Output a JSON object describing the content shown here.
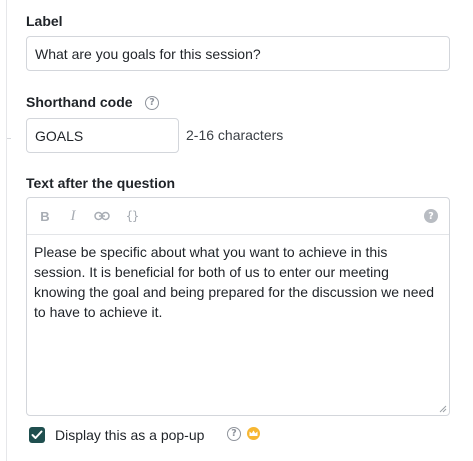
{
  "label_field": {
    "title": "Label",
    "value": "What are you goals for this session?"
  },
  "shorthand": {
    "title": "Shorthand code",
    "help_icon": "question-circle-icon",
    "value": "GOALS",
    "hint": "2-16 characters"
  },
  "text_after": {
    "title": "Text after the question",
    "toolbar": {
      "bold": "B",
      "italic": "I",
      "link_icon": "link-icon",
      "code": "{}",
      "help_icon": "question-filled-icon"
    },
    "body": "Please be specific about what you want to achieve in this session. It is beneficial for both of us to enter our meeting knowing the goal and being prepared for the discussion we need to have to achieve it."
  },
  "popup_option": {
    "checked": true,
    "label": "Display this as a pop-up",
    "help_icon": "question-circle-icon",
    "premium_icon": "crown-icon"
  },
  "colors": {
    "checkbox": "#1f4f4f",
    "premium": "#f7b733",
    "border": "#d3d6db"
  }
}
